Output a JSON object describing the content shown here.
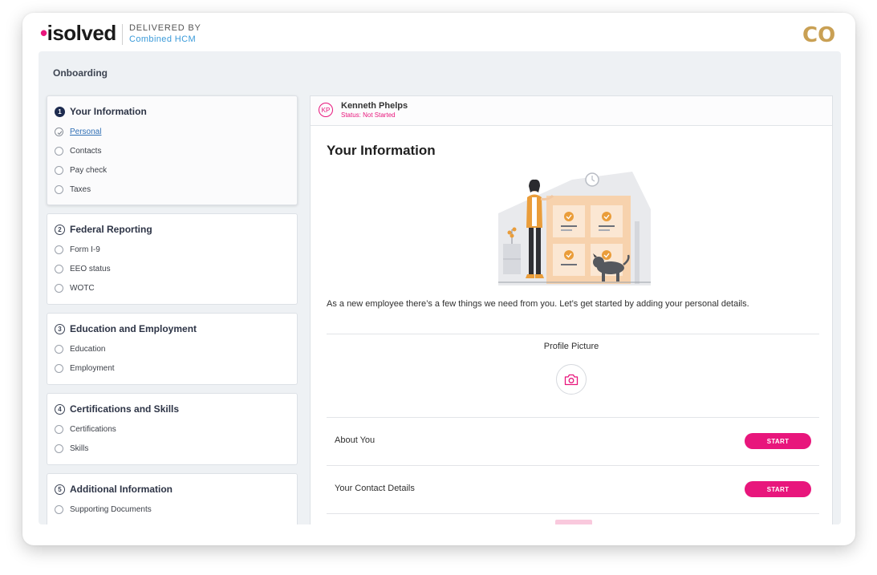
{
  "brand": {
    "logo_dot": "•",
    "logo_text": "isolved",
    "delivered_by": "DELIVERED BY",
    "company": "Combined HCM",
    "partner_logo": "CO",
    "pink": "#e8167c",
    "gold": "#c9a054"
  },
  "page": {
    "title": "Onboarding"
  },
  "steps": [
    {
      "number": "1",
      "title": "Your Information",
      "items": [
        {
          "label": "Personal",
          "state": "checked"
        },
        {
          "label": "Contacts",
          "state": "empty"
        },
        {
          "label": "Pay check",
          "state": "empty"
        },
        {
          "label": "Taxes",
          "state": "empty"
        }
      ]
    },
    {
      "number": "2",
      "title": "Federal Reporting",
      "items": [
        {
          "label": "Form I-9"
        },
        {
          "label": "EEO status"
        },
        {
          "label": "WOTC"
        }
      ]
    },
    {
      "number": "3",
      "title": "Education and Employment",
      "items": [
        {
          "label": "Education"
        },
        {
          "label": "Employment"
        }
      ]
    },
    {
      "number": "4",
      "title": "Certifications and Skills",
      "items": [
        {
          "label": "Certifications"
        },
        {
          "label": "Skills"
        }
      ]
    },
    {
      "number": "5",
      "title": "Additional Information",
      "items": [
        {
          "label": "Supporting Documents"
        }
      ]
    }
  ],
  "employee": {
    "initials": "KP",
    "name": "Kenneth Phelps",
    "status": "Status: Not Started"
  },
  "main": {
    "section_title": "Your Information",
    "intro": "As a new employee there’s a few things we need from you. Let’s get started by adding your personal details.",
    "profile_picture_label": "Profile Picture",
    "rows": [
      {
        "label": "About You",
        "button": "START"
      },
      {
        "label": "Your Contact Details",
        "button": "START"
      }
    ]
  }
}
